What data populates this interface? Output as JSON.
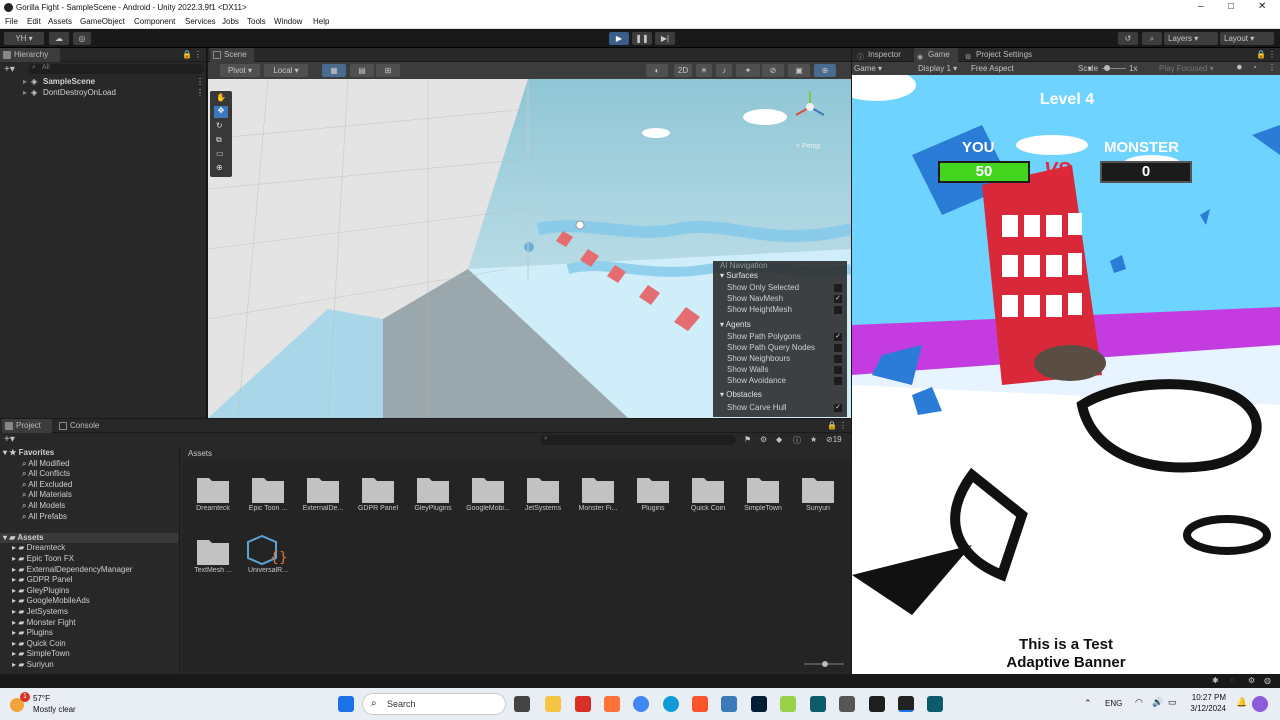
{
  "window": {
    "title": "Gorilla Fight - SampleScene - Android - Unity 2022.3.9f1 <DX11>"
  },
  "menu": [
    "File",
    "Edit",
    "Assets",
    "GameObject",
    "Component",
    "Services",
    "Jobs",
    "Tools",
    "Window",
    "Help"
  ],
  "toolbar": {
    "account": "YH",
    "layers": "Layers",
    "layout": "Layout"
  },
  "hierarchy": {
    "tab": "Hierarchy",
    "search_placeholder": "All",
    "items": [
      "SampleScene",
      "DontDestroyOnLoad"
    ]
  },
  "scene": {
    "tab": "Scene",
    "pivot": "Pivot",
    "local": "Local",
    "mode_2d": "2D",
    "gizmo_label": "< Persp",
    "nav_popup": {
      "title": "AI Navigation",
      "surfaces_header": "Surfaces",
      "surfaces": [
        {
          "label": "Show Only Selected",
          "checked": false
        },
        {
          "label": "Show NavMesh",
          "checked": true
        },
        {
          "label": "Show HeightMesh",
          "checked": false
        }
      ],
      "agents_header": "Agents",
      "agents": [
        {
          "label": "Show Path Polygons",
          "checked": true
        },
        {
          "label": "Show Path Query Nodes",
          "checked": false
        },
        {
          "label": "Show Neighbours",
          "checked": false
        },
        {
          "label": "Show Walls",
          "checked": false
        },
        {
          "label": "Show Avoidance",
          "checked": false
        }
      ],
      "obstacles_header": "Obstacles",
      "obstacles": [
        {
          "label": "Show Carve Hull",
          "checked": true
        }
      ]
    }
  },
  "right_tabs": [
    "Inspector",
    "Game",
    "Project Settings"
  ],
  "game": {
    "mode": "Game",
    "display": "Display 1",
    "aspect": "Free Aspect",
    "scale_label": "Scale",
    "scale_value": "1x",
    "play_focused": "Play Focused",
    "level": "Level 4",
    "you_label": "YOU",
    "you_score": "50",
    "vs": "VS",
    "monster_label": "MONSTER",
    "monster_score": "0",
    "banner_line1": "This is a Test",
    "banner_line2": "Adaptive Banner"
  },
  "project": {
    "tabs": [
      "Project",
      "Console"
    ],
    "hidden_count": "19",
    "favorites_header": "Favorites",
    "favorites": [
      "All Modified",
      "All Conflicts",
      "All Excluded",
      "All Materials",
      "All Models",
      "All Prefabs"
    ],
    "assets_header": "Assets",
    "tree": [
      "Dreamteck",
      "Epic Toon FX",
      "ExternalDependencyManager",
      "GDPR Panel",
      "GleyPlugins",
      "GoogleMobileAds",
      "JetSystems",
      "Monster Fight",
      "Plugins",
      "Quick Coin",
      "SimpleTown",
      "Suriyun"
    ],
    "breadcrumb": "Assets",
    "grid": [
      "Dreamteck",
      "Epic Toon ...",
      "ExternalDe...",
      "GDPR Panel",
      "GleyPlugins",
      "GoogleMobi...",
      "JetSystems",
      "Monster Fi...",
      "Plugins",
      "Quick Coin",
      "SimpleTown",
      "Suriyun",
      "TextMesh ...",
      "UniversalR..."
    ]
  },
  "taskbar": {
    "weather_temp": "57°F",
    "weather_desc": "Mostly clear",
    "weather_badge": "1",
    "search": "Search",
    "lang": "ENG",
    "time": "10:27 PM",
    "date": "3/12/2024"
  },
  "colors": {
    "editor_bg": "#282828",
    "accent": "#3a79bb",
    "sky": "#6fd3ff",
    "track_purple": "#c43be0"
  }
}
